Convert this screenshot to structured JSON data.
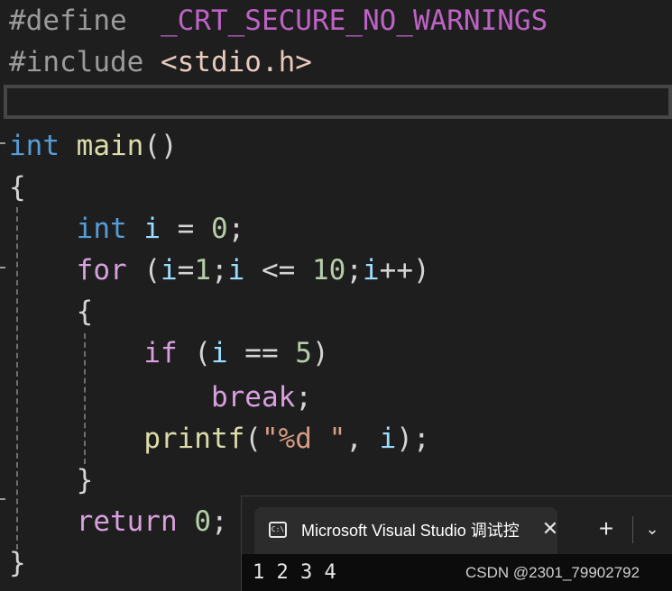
{
  "editor": {
    "line1": {
      "directive": "#define",
      "macro": "_CRT_SECURE_NO_WARNINGS"
    },
    "line2": {
      "directive": "#include",
      "header": "<stdio.h>"
    },
    "line4": {
      "type": "int",
      "name": "main",
      "parens": "()"
    },
    "line5": {
      "brace": "{"
    },
    "line6": {
      "type": "int",
      "var": "i",
      "eq": " = ",
      "num": "0",
      "semi": ";"
    },
    "line7": {
      "kw": "for",
      "open": " (",
      "v1": "i",
      "eq": "=",
      "n1": "1",
      "s1": ";",
      "v2": "i",
      "op": " <= ",
      "n2": "10",
      "s2": ";",
      "v3": "i",
      "inc": "++",
      "close": ")"
    },
    "line8": {
      "brace": "{"
    },
    "line9": {
      "kw": "if",
      "open": " (",
      "var": "i",
      "op": " == ",
      "num": "5",
      "close": ")"
    },
    "line10": {
      "kw": "break",
      "semi": ";"
    },
    "line11": {
      "fn": "printf",
      "open": "(",
      "str": "\"%d \"",
      "comma": ", ",
      "var": "i",
      "close": ");"
    },
    "line12": {
      "brace": "}"
    },
    "line13": {
      "kw": "return",
      "num": "0",
      "semi": ";"
    },
    "line14": {
      "brace": "}"
    }
  },
  "terminal": {
    "icon": "cmd-icon",
    "icon_text": "C:\\",
    "tab_title": "Microsoft Visual Studio 调试控",
    "close_glyph": "✕",
    "add_glyph": "+",
    "dropdown_glyph": "⌄",
    "output": "1 2 3 4",
    "watermark": "CSDN @2301_79902792"
  },
  "colors": {
    "background": "#1e1e1e",
    "keyword": "#569cd6",
    "control": "#d8a0df",
    "function": "#dcdcaa",
    "variable": "#9cdcfe",
    "number": "#b5cea8",
    "string": "#d69d85"
  }
}
